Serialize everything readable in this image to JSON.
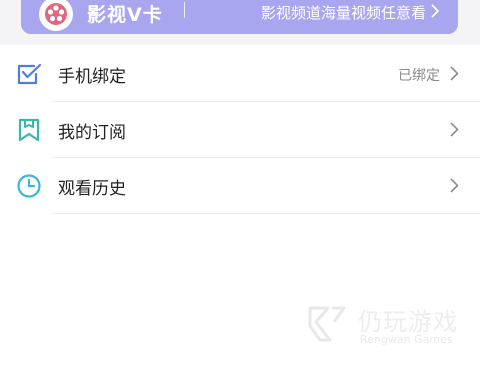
{
  "vcard": {
    "title": "影视V卡",
    "description": "影视频道海量视频任意看"
  },
  "menu": [
    {
      "label": "手机绑定",
      "status": "已绑定",
      "icon": "phone-bind-icon"
    },
    {
      "label": "我的订阅",
      "status": "",
      "icon": "bookmark-icon"
    },
    {
      "label": "观看历史",
      "status": "",
      "icon": "clock-icon"
    }
  ],
  "watermark": {
    "name": "仍玩游戏",
    "en": "Rengwan Games"
  },
  "colors": {
    "card": "#a9a6f0",
    "icon_blue": "#4b7fe0",
    "icon_teal": "#3bb7a6",
    "icon_cyan": "#39b9d6",
    "logo_pink": "#e2677e"
  }
}
